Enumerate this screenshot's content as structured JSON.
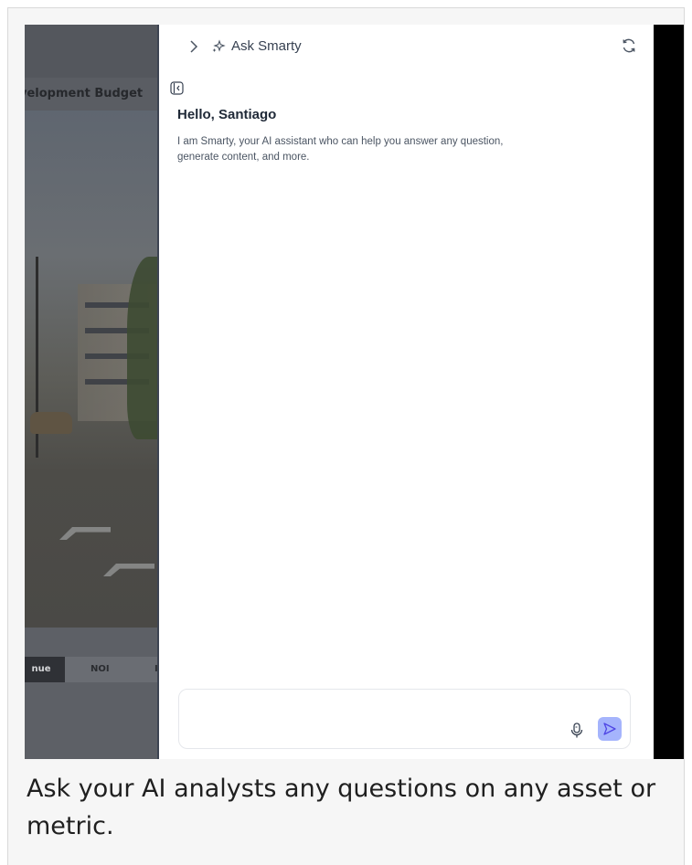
{
  "background_app": {
    "section_title": "velopment Budget",
    "tabs": [
      "nue",
      "NOI",
      "I"
    ]
  },
  "assistant": {
    "header_title": "Ask Smarty",
    "greeting": "Hello, Santiago",
    "intro": "I am Smarty, your AI assistant who can help you answer any question, generate content, and more.",
    "input": {
      "value": "",
      "placeholder": ""
    }
  },
  "caption": "Ask your AI analysts any questions on any asset or metric.",
  "colors": {
    "accent": "#a5b4fc",
    "panel_bg": "#ffffff",
    "overlay": "#5c5f66"
  },
  "icons": {
    "collapse": "chevron-right-icon",
    "assistant": "sparkle-icon",
    "refresh": "refresh-icon",
    "sidebar_toggle": "sidebar-collapse-icon",
    "mic": "microphone-icon",
    "send": "send-icon"
  }
}
